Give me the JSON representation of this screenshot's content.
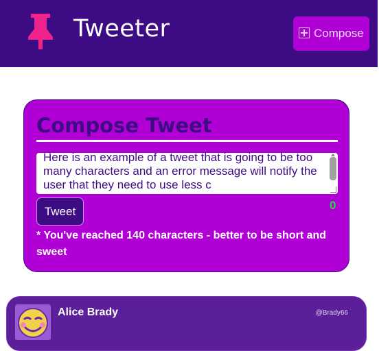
{
  "navbar": {
    "brand": "Tweeter",
    "compose_label": "Compose"
  },
  "compose": {
    "title": "Compose Tweet",
    "text": "Here is an example of a tweet that is going to be too many characters and an error message will notify the user that they need to use less c",
    "counter": "0",
    "tweet_button": "Tweet",
    "error_message": "* You've reached 140 characters - better to be short and sweet"
  },
  "tweets": [
    {
      "name": "Alice Brady",
      "handle": "@Brady66"
    }
  ],
  "colors": {
    "nav_bg": "#3d0c84",
    "accent": "#b000d6",
    "counter": "#22dd44",
    "pin": "#f0228c"
  }
}
